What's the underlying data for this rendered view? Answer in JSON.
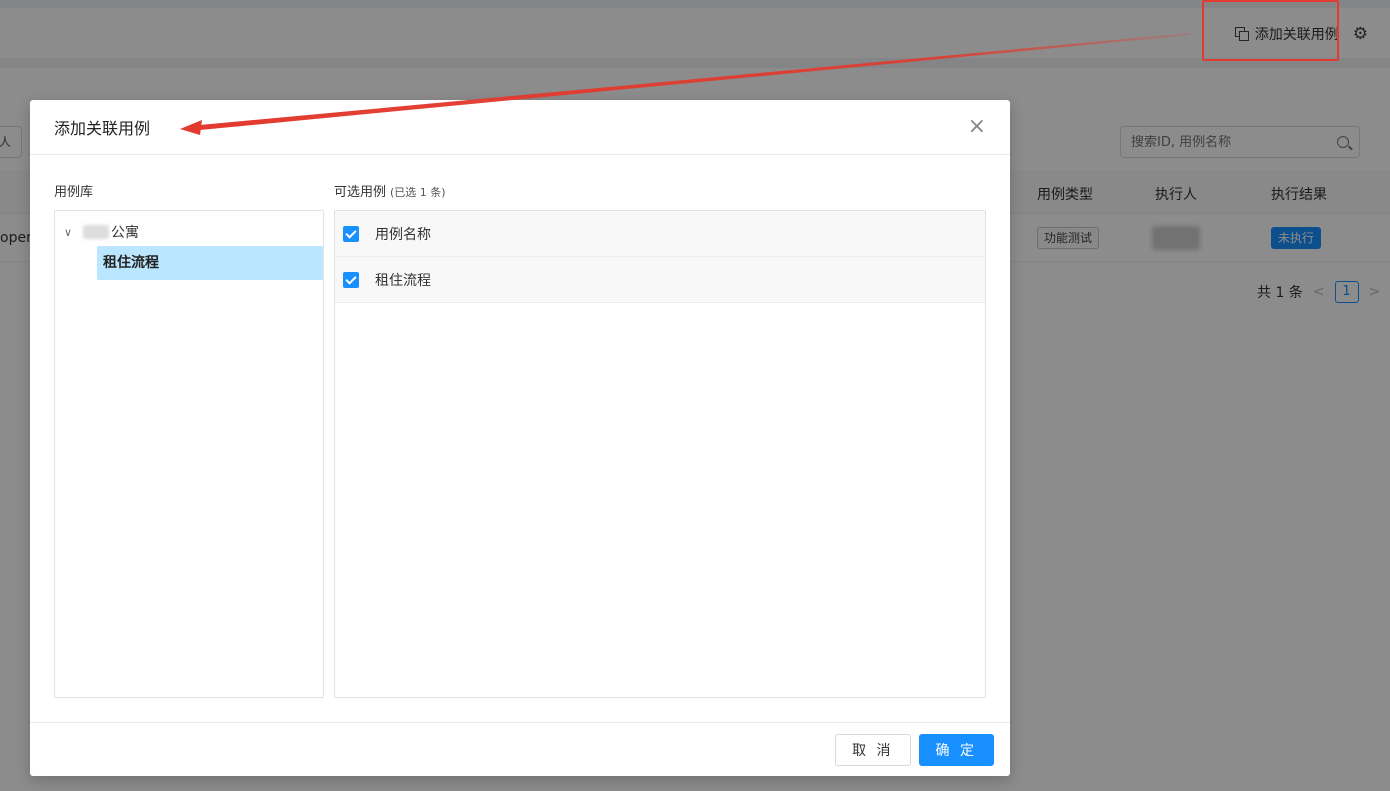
{
  "background": {
    "top_action_label": "添加关联用例",
    "left_partial_button": "人",
    "search": {
      "placeholder": "搜索ID, 用例名称"
    },
    "table": {
      "headers": {
        "case_type": "用例类型",
        "executor": "执行人",
        "result": "执行结果"
      },
      "row": {
        "left_partial": "open",
        "case_type": "功能测试",
        "result": "未执行"
      }
    },
    "pagination": {
      "total": "共 1 条",
      "prev": "<",
      "current": "1",
      "next": ">"
    }
  },
  "modal": {
    "title": "添加关联用例",
    "close_symbol": "×",
    "library_label": "用例库",
    "available_label": "可选用例",
    "selected_count": "(已选 1 条)",
    "tree": {
      "root_label": "公寓",
      "child_label": "租住流程"
    },
    "cases": [
      {
        "label": "用例名称",
        "checked": true
      },
      {
        "label": "租住流程",
        "checked": true
      }
    ],
    "footer": {
      "cancel_label": "取 消",
      "ok_label": "确 定"
    }
  },
  "colors": {
    "accent": "#1890ff",
    "annotation": "#e23a2e",
    "tree_selected": "#bae7ff"
  }
}
